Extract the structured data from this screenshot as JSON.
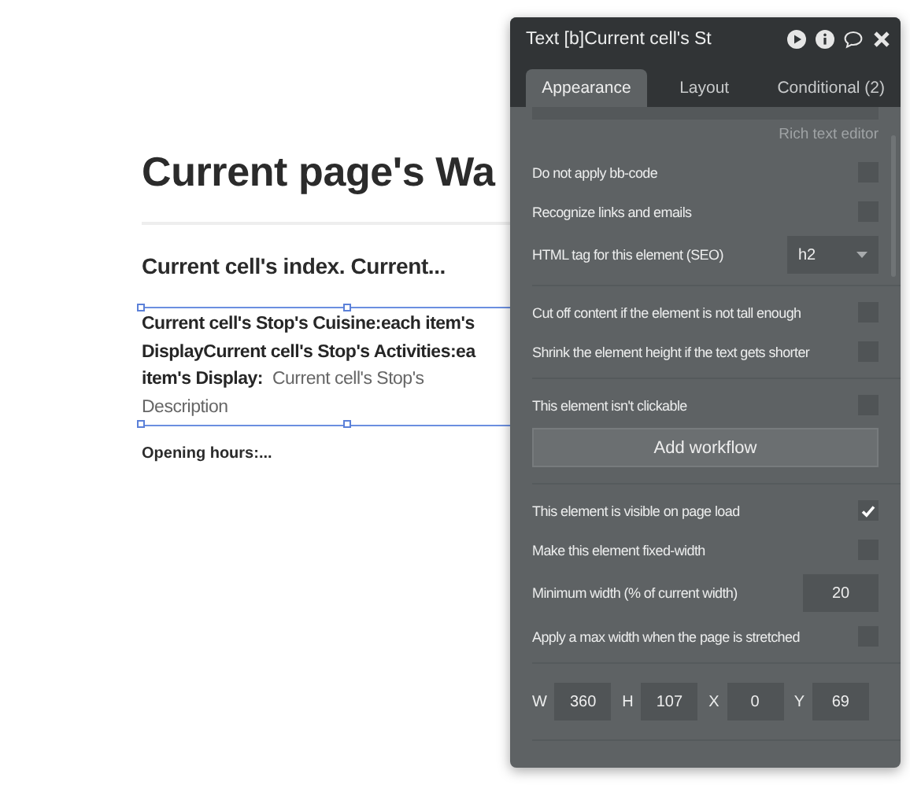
{
  "canvas": {
    "heading": "Current page's Wa",
    "subheading": "Current cell's index. Current...",
    "body_lines": [
      {
        "segments": [
          {
            "text": "Current cell's Stop's Cuisine:each item's",
            "kind": "bold"
          }
        ]
      },
      {
        "segments": [
          {
            "text": "DisplayCurrent cell's Stop's Activities:ea",
            "kind": "bold"
          }
        ]
      },
      {
        "segments": [
          {
            "text": "item's Display:",
            "kind": "bold"
          },
          {
            "text": "Current cell's Stop's",
            "kind": "light"
          }
        ]
      },
      {
        "segments": [
          {
            "text": "Description",
            "kind": "light"
          }
        ]
      }
    ],
    "footer": "Opening hours:..."
  },
  "panel": {
    "title": "Text [b]Current cell's St",
    "tabs": [
      {
        "label": "Appearance",
        "selected": true
      },
      {
        "label": "Layout",
        "selected": false
      },
      {
        "label": "Conditional (2)",
        "selected": false
      }
    ],
    "link": "Rich text editor",
    "rows": [
      {
        "kind": "checkbox",
        "label": "Do not apply bb-code",
        "checked": false
      },
      {
        "kind": "checkbox",
        "label": "Recognize links and emails",
        "checked": false
      },
      {
        "kind": "dropdown",
        "label": "HTML tag for this element (SEO)",
        "value": "h2"
      },
      {
        "kind": "divider"
      },
      {
        "kind": "checkbox",
        "label": "Cut off content if the element is not tall enough",
        "checked": false
      },
      {
        "kind": "checkbox",
        "label": "Shrink the element height if the text gets shorter",
        "checked": false
      },
      {
        "kind": "divider"
      },
      {
        "kind": "checkbox",
        "label": "This element isn't clickable",
        "checked": false
      },
      {
        "kind": "button",
        "label": "Add workflow"
      },
      {
        "kind": "divider"
      },
      {
        "kind": "checkbox",
        "label": "This element is visible on page load",
        "checked": true
      },
      {
        "kind": "checkbox",
        "label": "Make this element fixed-width",
        "checked": false
      },
      {
        "kind": "number",
        "label": "Minimum width (% of current width)",
        "value": "20"
      },
      {
        "kind": "checkbox",
        "label": "Apply a max width when the page is stretched",
        "checked": false
      },
      {
        "kind": "divider"
      },
      {
        "kind": "dims",
        "fields": [
          {
            "label": "W",
            "value": "360"
          },
          {
            "label": "H",
            "value": "107"
          },
          {
            "label": "X",
            "value": "0"
          },
          {
            "label": "Y",
            "value": "69"
          }
        ]
      },
      {
        "kind": "divider"
      }
    ]
  }
}
